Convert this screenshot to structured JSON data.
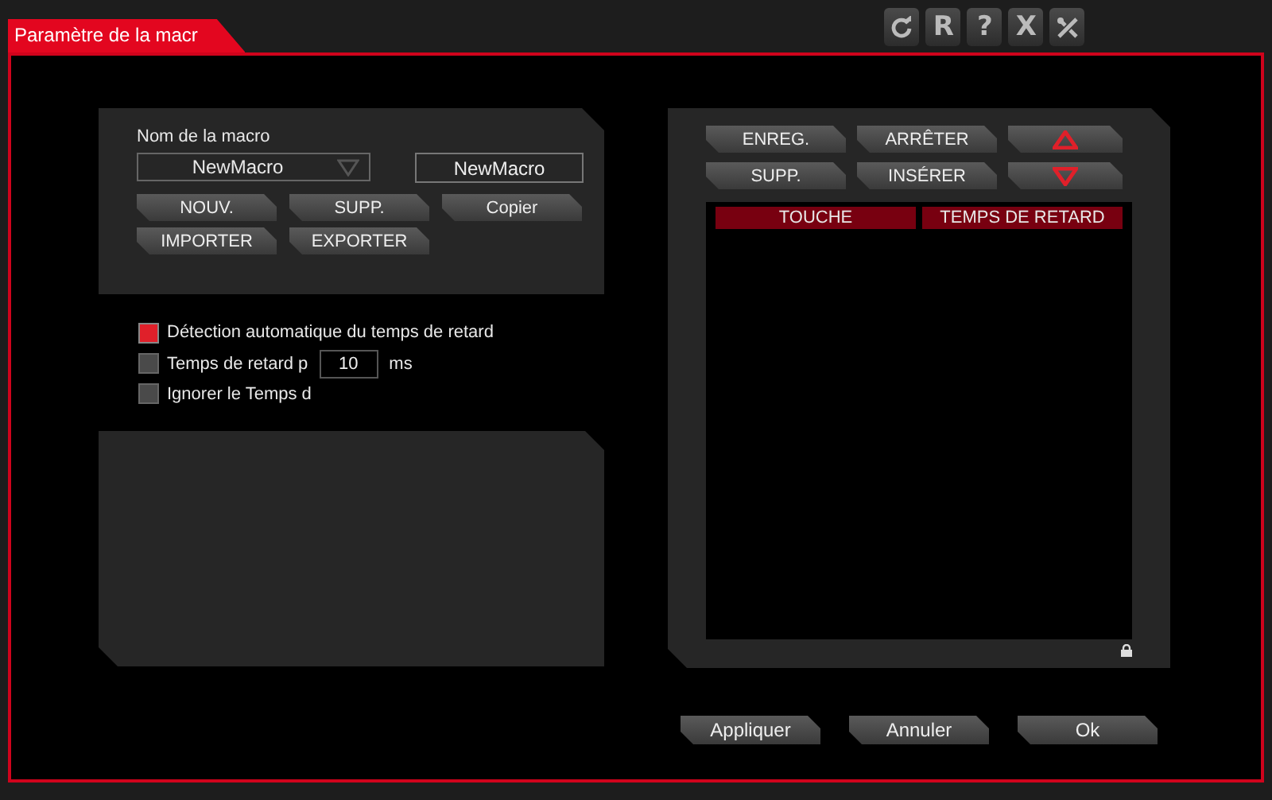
{
  "window": {
    "title": "Paramètre de la macr"
  },
  "toolbar": [
    {
      "kind": "refresh"
    },
    {
      "kind": "text",
      "label": "R"
    },
    {
      "kind": "text",
      "label": "?"
    },
    {
      "kind": "text",
      "label": "X"
    },
    {
      "kind": "tools"
    }
  ],
  "macro": {
    "label": "Nom de la macro",
    "dropdown_value": "NewMacro",
    "name_value": "NewMacro",
    "buttons": [
      "NOUV.",
      "SUPP.",
      "Copier",
      "IMPORTER",
      "EXPORTER"
    ]
  },
  "options": [
    {
      "kind": "check",
      "label": "Détection automatique du temps de retard",
      "checked": true
    },
    {
      "kind": "delay",
      "label": "Temps de retard p",
      "value": "10",
      "unit": "ms",
      "checked": false
    },
    {
      "kind": "check",
      "label": "Ignorer le Temps d",
      "checked": false
    }
  ],
  "record": {
    "buttons": [
      {
        "kind": "text",
        "label": "ENREG."
      },
      {
        "kind": "text",
        "label": "ARRÊTER"
      },
      {
        "kind": "up"
      },
      {
        "kind": "text",
        "label": "SUPP."
      },
      {
        "kind": "text",
        "label": "INSÉRER"
      },
      {
        "kind": "down"
      }
    ],
    "columns": [
      "TOUCHE",
      "TEMPS DE RETARD"
    ]
  },
  "footer_buttons": [
    "Appliquer",
    "Annuler",
    "Ok"
  ]
}
